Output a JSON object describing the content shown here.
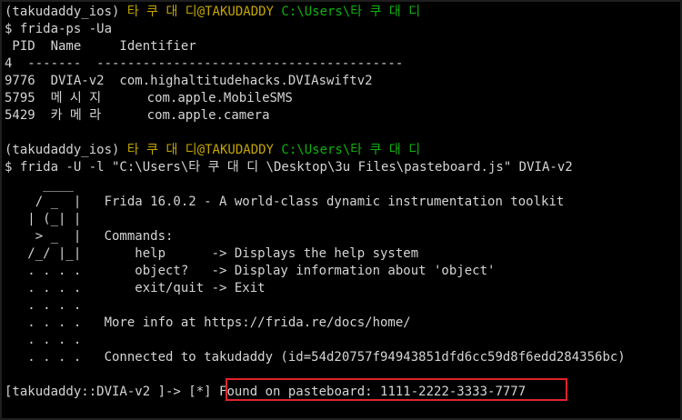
{
  "colors": {
    "background": "#000000",
    "text": "#d4d4d4",
    "prompt_path": "#0fb20f",
    "prompt_user": "#c3a600",
    "highlight_box": "#e0232b"
  },
  "prompt1": {
    "env": "(takudaddy_ios)",
    "user": "타 쿠 대 디",
    "host": "@TAKUDADDY",
    "path": "C:\\Users\\타 쿠 대 디"
  },
  "cmd1": "$ frida-ps -Ua",
  "ps_header": " PID  Name     Identifier",
  "ps_sep": "4  -------  ----------------------------------------",
  "ps_rows": [
    "9776  DVIA-v2  com.highaltitudehacks.DVIAswiftv2",
    "5795  메 시 지      com.apple.MobileSMS",
    "5429  카 메 라      com.apple.camera"
  ],
  "prompt2": {
    "env": "(takudaddy_ios)",
    "user": "타 쿠 대 디",
    "host": "@TAKUDADDY",
    "path": "C:\\Users\\타 쿠 대 디"
  },
  "cmd2": "$ frida -U -l \"C:\\Users\\타 쿠 대 디 \\Desktop\\3u Files\\pasteboard.js\" DVIA-v2",
  "banner_lines": [
    "     ____",
    "    / _  |   Frida 16.0.2 - A world-class dynamic instrumentation toolkit",
    "   | (_| |",
    "    > _  |   Commands:",
    "   /_/ |_|       help      -> Displays the help system",
    "   . . . .       object?   -> Display information about 'object'",
    "   . . . .       exit/quit -> Exit",
    "   . . . .",
    "   . . . .   More info at https://frida.re/docs/home/",
    "   . . . .",
    "   . . . .   Connected to takudaddy (id=54d20757f94943851dfd6cc59d8f6edd284356bc)"
  ],
  "repl_prompt": "[takudaddy::DVIA-v2 ]-> [*] ",
  "found_message": "Found on pasteboard: 1111-2222-3333-7777"
}
